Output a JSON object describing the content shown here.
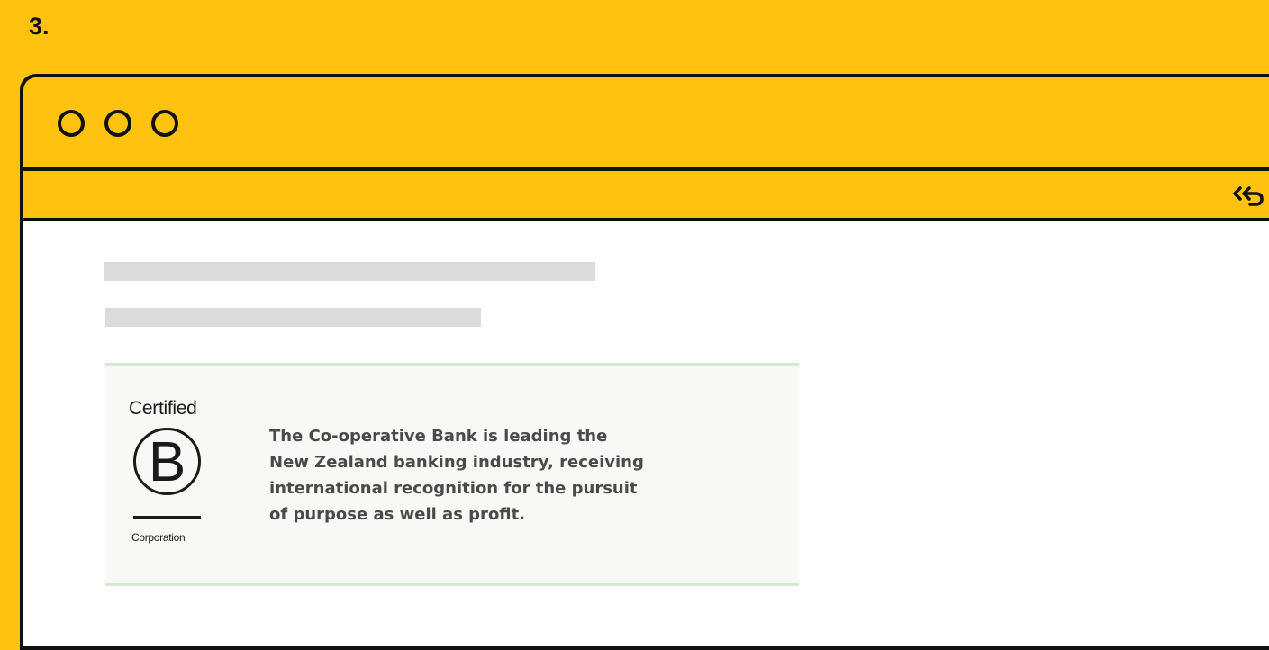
{
  "step": {
    "number": "3."
  },
  "window": {
    "controls": [
      "close",
      "minimize",
      "maximize"
    ],
    "toolbar": {
      "share_icon": "share-back-icon"
    }
  },
  "content": {
    "placeholder_lines": 2,
    "promo": {
      "badge": {
        "top_text": "Certified",
        "letter": "B",
        "bottom_text": "Corporation"
      },
      "text": "The Co-operative Bank is leading the\nNew Zealand banking industry, receiving\ninternational recognition for the pursuit\nof purpose as well as profit."
    }
  },
  "colors": {
    "background": "#FEC20F",
    "outline": "#111111",
    "content_bg": "#FFFFFF",
    "placeholder": "#DCDADA",
    "card_border": "#D5E8D2"
  }
}
